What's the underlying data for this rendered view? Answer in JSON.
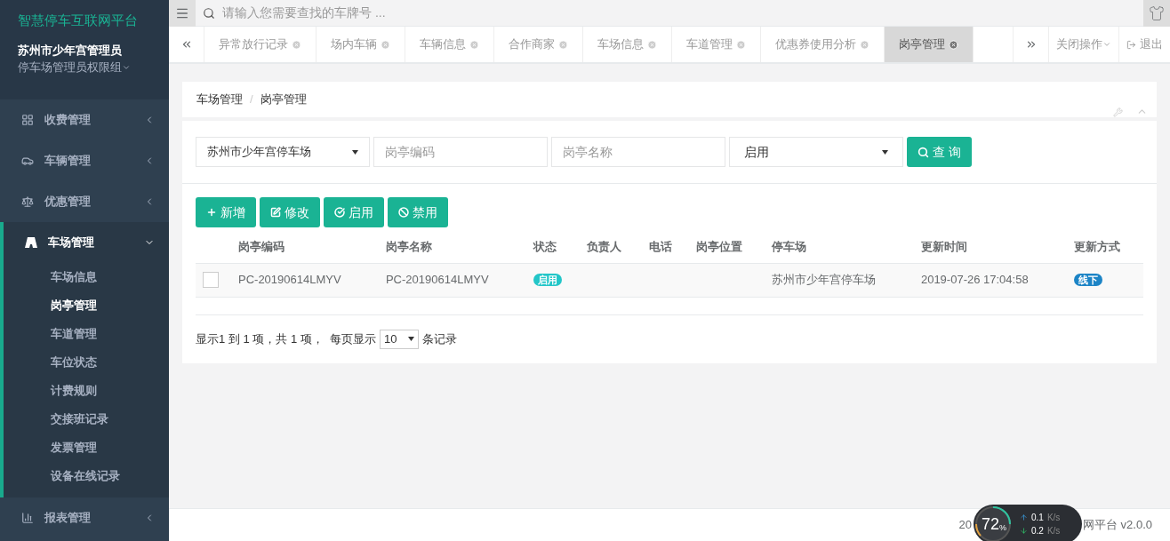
{
  "brand": "智慧停车互联网平台",
  "user": {
    "name": "苏州市少年宫管理员",
    "role": "停车场管理员权限组"
  },
  "sidebar": {
    "items": [
      {
        "label": "收费管理",
        "expanded": false
      },
      {
        "label": "车辆管理",
        "expanded": false
      },
      {
        "label": "优惠管理",
        "expanded": false
      },
      {
        "label": "车场管理",
        "expanded": true,
        "children": [
          {
            "label": "车场信息",
            "selected": false
          },
          {
            "label": "岗亭管理",
            "selected": true
          },
          {
            "label": "车道管理",
            "selected": false
          },
          {
            "label": "车位状态",
            "selected": false
          },
          {
            "label": "计费规则",
            "selected": false
          },
          {
            "label": "交接班记录",
            "selected": false
          },
          {
            "label": "发票管理",
            "selected": false
          },
          {
            "label": "设备在线记录",
            "selected": false
          }
        ]
      },
      {
        "label": "报表管理",
        "expanded": false
      }
    ]
  },
  "search": {
    "placeholder": "请输入您需要查找的车牌号 ..."
  },
  "tabs": [
    {
      "label": "异常放行记录",
      "selected": false
    },
    {
      "label": "场内车辆",
      "selected": false
    },
    {
      "label": "车辆信息",
      "selected": false
    },
    {
      "label": "合作商家",
      "selected": false
    },
    {
      "label": "车场信息",
      "selected": false
    },
    {
      "label": "车道管理",
      "selected": false
    },
    {
      "label": "优惠券使用分析",
      "selected": false
    },
    {
      "label": "岗亭管理",
      "selected": true
    }
  ],
  "tab_actions": {
    "close_ops": "关闭操作",
    "logout": "退出"
  },
  "breadcrumb": {
    "items": [
      "车场管理",
      "岗亭管理"
    ],
    "separator": "/"
  },
  "filters": {
    "lot": "苏州市少年宫停车场",
    "code_placeholder": "岗亭编码",
    "name_placeholder": "岗亭名称",
    "status": "启用",
    "query": "查 询"
  },
  "actions": [
    {
      "label": "新增"
    },
    {
      "label": "修改"
    },
    {
      "label": "启用"
    },
    {
      "label": "禁用"
    }
  ],
  "table": {
    "columns": [
      "岗亭编码",
      "岗亭名称",
      "状态",
      "负责人",
      "电话",
      "岗亭位置",
      "停车场",
      "更新时间",
      "更新方式"
    ],
    "rows": [
      {
        "checked": false,
        "cells": [
          "PC-20190614LMYV",
          "PC-20190614LMYV",
          "启用",
          "",
          "",
          "",
          "苏州市少年宫停车场",
          "2019-07-26 17:04:58",
          "线下"
        ]
      }
    ]
  },
  "pagination": {
    "summary": "显示1 到 1 项，共 1 项，  每页显示",
    "page_size": "10",
    "suffix": "条记录"
  },
  "footer": {
    "prefix": "20",
    "text": "网平台 v2.0.0"
  },
  "speed_widget": {
    "percent": "72",
    "unit": "%",
    "up": "0.1",
    "up_unit": "K/s",
    "down": "0.2",
    "down_unit": "K/s"
  }
}
